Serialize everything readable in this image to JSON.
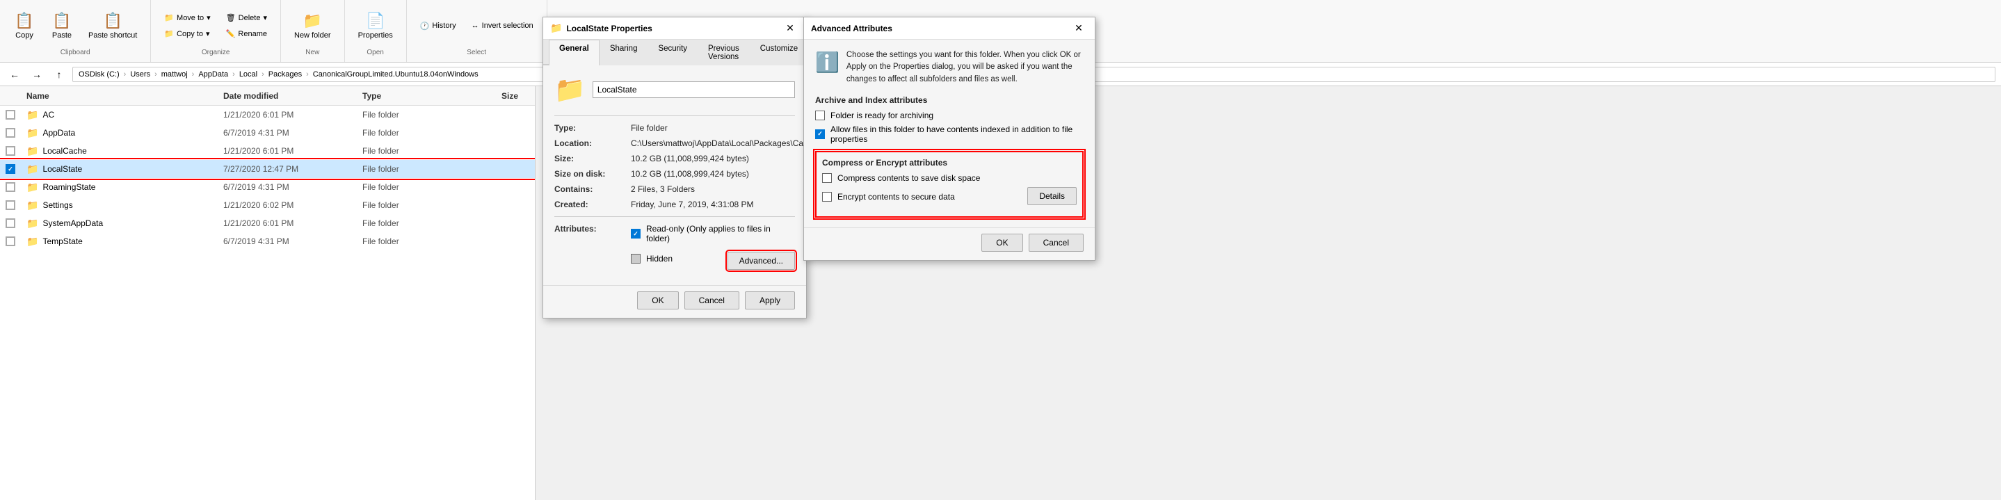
{
  "ribbon": {
    "sections": [
      {
        "id": "clipboard",
        "title": "Clipboard",
        "buttons": [
          {
            "id": "copy",
            "label": "Copy",
            "icon": "📋"
          },
          {
            "id": "paste",
            "label": "Paste",
            "icon": "📋"
          },
          {
            "id": "paste-shortcut",
            "label": "Paste shortcut",
            "icon": "📋"
          }
        ]
      },
      {
        "id": "organize",
        "title": "Organize",
        "buttons": [
          {
            "id": "move-to",
            "label": "Move to",
            "icon": "📁"
          },
          {
            "id": "copy-to",
            "label": "Copy to",
            "icon": "📁"
          },
          {
            "id": "delete",
            "label": "Delete",
            "icon": "🗑"
          },
          {
            "id": "rename",
            "label": "Rename",
            "icon": "✏️"
          }
        ]
      },
      {
        "id": "new",
        "title": "New",
        "buttons": [
          {
            "id": "new-folder",
            "label": "New folder",
            "icon": "📁"
          }
        ]
      },
      {
        "id": "open",
        "title": "Open",
        "buttons": [
          {
            "id": "properties",
            "label": "Properties",
            "icon": "📄"
          }
        ]
      },
      {
        "id": "select",
        "title": "Select",
        "buttons": [
          {
            "id": "history",
            "label": "History",
            "icon": "🕐"
          },
          {
            "id": "invert-selection",
            "label": "Invert selection",
            "icon": "↔"
          }
        ]
      }
    ]
  },
  "addressbar": {
    "back_title": "Back",
    "forward_title": "Forward",
    "up_title": "Up",
    "path_segments": [
      "OSDisk (C:)",
      "Users",
      "mattwoj",
      "AppData",
      "Local",
      "Packages",
      "CanonicalGroupLimited.Ubuntu18.04onWindows"
    ]
  },
  "file_list": {
    "headers": {
      "name": "Name",
      "date_modified": "Date modified",
      "type": "Type",
      "size": "Size"
    },
    "rows": [
      {
        "id": "ac",
        "name": "AC",
        "date": "1/21/2020 6:01 PM",
        "type": "File folder",
        "size": "",
        "selected": false,
        "checked": false
      },
      {
        "id": "appdata",
        "name": "AppData",
        "date": "6/7/2019 4:31 PM",
        "type": "File folder",
        "size": "",
        "selected": false,
        "checked": false
      },
      {
        "id": "localcache",
        "name": "LocalCache",
        "date": "1/21/2020 6:01 PM",
        "type": "File folder",
        "size": "",
        "selected": false,
        "checked": false
      },
      {
        "id": "localstate",
        "name": "LocalState",
        "date": "7/27/2020 12:47 PM",
        "type": "File folder",
        "size": "",
        "selected": true,
        "checked": true
      },
      {
        "id": "roamingstate",
        "name": "RoamingState",
        "date": "6/7/2019 4:31 PM",
        "type": "File folder",
        "size": "",
        "selected": false,
        "checked": false
      },
      {
        "id": "settings",
        "name": "Settings",
        "date": "1/21/2020 6:02 PM",
        "type": "File folder",
        "size": "",
        "selected": false,
        "checked": false
      },
      {
        "id": "systemappdata",
        "name": "SystemAppData",
        "date": "1/21/2020 6:01 PM",
        "type": "File folder",
        "size": "",
        "selected": false,
        "checked": false
      },
      {
        "id": "tempstate",
        "name": "TempState",
        "date": "6/7/2019 4:31 PM",
        "type": "File folder",
        "size": "",
        "selected": false,
        "checked": false
      }
    ]
  },
  "properties_dialog": {
    "title": "LocalState Properties",
    "tabs": [
      "General",
      "Sharing",
      "Security",
      "Previous Versions",
      "Customize"
    ],
    "active_tab": "General",
    "folder_name": "LocalState",
    "props": [
      {
        "label": "Type:",
        "value": "File folder"
      },
      {
        "label": "Location:",
        "value": "C:\\Users\\mattwoj\\AppData\\Local\\Packages\\Canonic"
      },
      {
        "label": "Size:",
        "value": "10.2 GB (11,008,999,424 bytes)"
      },
      {
        "label": "Size on disk:",
        "value": "10.2 GB (11,008,999,424 bytes)"
      },
      {
        "label": "Contains:",
        "value": "2 Files, 3 Folders"
      },
      {
        "label": "Created:",
        "value": "Friday, June 7, 2019, 4:31:08 PM"
      }
    ],
    "attributes_label": "Attributes:",
    "readonly_label": "Read-only (Only applies to files in folder)",
    "hidden_label": "Hidden",
    "advanced_button": "Advanced...",
    "ok_button": "OK",
    "cancel_button": "Cancel",
    "apply_button": "Apply"
  },
  "advanced_dialog": {
    "title": "Advanced Attributes",
    "info_text": "Choose the settings you want for this folder.\nWhen you click OK or Apply on the Properties dialog, you will be asked if you want the changes to affect all subfolders and files as well.",
    "archive_section_title": "Archive and Index attributes",
    "archive_label": "Folder is ready for archiving",
    "index_label": "Allow files in this folder to have contents indexed in addition to file properties",
    "index_checked": true,
    "compress_section_title": "Compress or Encrypt attributes",
    "compress_label": "Compress contents to save disk space",
    "encrypt_label": "Encrypt contents to secure data",
    "details_button": "Details",
    "ok_button": "OK",
    "cancel_button": "Cancel"
  }
}
